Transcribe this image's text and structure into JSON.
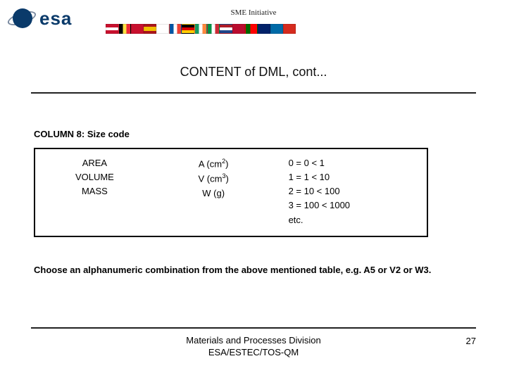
{
  "header": {
    "logo_text": "esa",
    "sme_label": "SME Initiative"
  },
  "flags": [
    {
      "name": "austria",
      "bg": "linear-gradient(#c8102e 33%,#fff 33% 66%,#c8102e 66%)"
    },
    {
      "name": "belgium",
      "bg": "linear-gradient(90deg,#000 33%,#fae042 33% 66%,#ed2939 66%)"
    },
    {
      "name": "denmark",
      "bg": "#c8102e"
    },
    {
      "name": "spain",
      "bg": "linear-gradient(#aa151b 25%,#f1bf00 25% 75%,#aa151b 75%)"
    },
    {
      "name": "finland",
      "bg": "#fff"
    },
    {
      "name": "france",
      "bg": "linear-gradient(90deg,#0055a4 33%,#fff 33% 66%,#ef4135 66%)"
    },
    {
      "name": "germany",
      "bg": "linear-gradient(#000 33%,#dd0000 33% 66%,#ffce00 66%)"
    },
    {
      "name": "ireland",
      "bg": "linear-gradient(90deg,#169b62 33%,#fff 33% 66%,#ff883e 66%)"
    },
    {
      "name": "italy",
      "bg": "linear-gradient(90deg,#009246 33%,#fff 33% 66%,#ce2b37 66%)"
    },
    {
      "name": "netherlands",
      "bg": "linear-gradient(#ae1c28 33%,#fff 33% 66%,#21468b 66%)"
    },
    {
      "name": "norway",
      "bg": "#ba0c2f"
    },
    {
      "name": "portugal",
      "bg": "linear-gradient(90deg,#006600 40%,#ff0000 40%)"
    },
    {
      "name": "uk",
      "bg": "#012169"
    },
    {
      "name": "sweden",
      "bg": "#006aa7"
    },
    {
      "name": "switzerland",
      "bg": "#d52b1e"
    }
  ],
  "title": "CONTENT of DML, cont...",
  "column8": {
    "heading": "COLUMN 8: Size code",
    "col1": [
      "AREA",
      "VOLUME",
      "MASS"
    ],
    "col2": [
      "A (cm²)",
      "V (cm³)",
      "W (g)"
    ],
    "col3": [
      "0 = 0 < 1",
      "1 = 1 < 10",
      "2 = 10 < 100",
      "3 = 100 < 1000",
      "etc."
    ]
  },
  "instruction": "Choose an alphanumeric combination from the above mentioned table, e.g. A5 or V2 or W3.",
  "footer": {
    "line1": "Materials and Processes Division",
    "line2": "ESA/ESTEC/TOS-QM",
    "page": "27"
  }
}
